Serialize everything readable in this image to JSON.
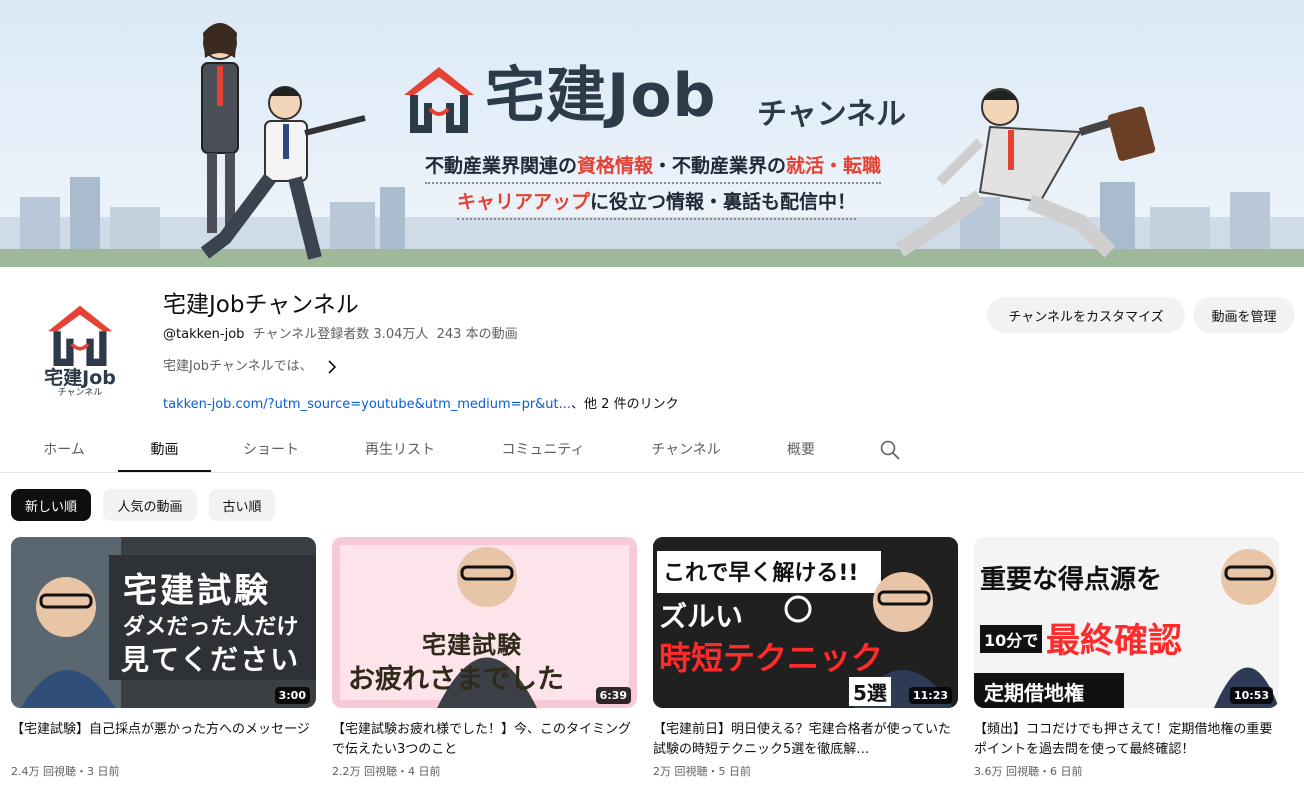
{
  "banner": {
    "title": "宅建Job",
    "subtitle": "チャンネル",
    "line1_a": "不動産業界関連の",
    "line1_hl1": "資格情報",
    "line1_b": "・不動産業界の",
    "line1_hl2": "就活・転職",
    "line2_hl": "キャリアアップ",
    "line2_b": "に役立つ情報・裏話も配信中！"
  },
  "channel": {
    "avatar_text": "宅建Job",
    "avatar_sub": "チャンネル",
    "name": "宅建Jobチャンネル",
    "handle": "@takken-job",
    "subscribers": "チャンネル登録者数 3.04万人",
    "video_count": "243 本の動画",
    "description": "宅建Jobチャンネルでは、",
    "link": "takken-job.com/?utm_source=youtube&utm_medium=pr&ut...",
    "link_more": "、他 2 件のリンク"
  },
  "actions": {
    "customize": "チャンネルをカスタマイズ",
    "manage": "動画を管理"
  },
  "tabs": [
    {
      "label": "ホーム"
    },
    {
      "label": "動画"
    },
    {
      "label": "ショート"
    },
    {
      "label": "再生リスト"
    },
    {
      "label": "コミュニティ"
    },
    {
      "label": "チャンネル"
    },
    {
      "label": "概要"
    }
  ],
  "chips": [
    {
      "label": "新しい順"
    },
    {
      "label": "人気の動画"
    },
    {
      "label": "古い順"
    }
  ],
  "videos": [
    {
      "thumb_lines": [
        "宅建試験",
        "ダメだった人だけ",
        "見てください"
      ],
      "duration": "3:00",
      "title": "【宅建試験】自己採点が悪かった方へのメッセージ",
      "meta": "2.4万 回視聴・3 日前",
      "progress": 0.0
    },
    {
      "thumb_lines": [
        "宅建試験",
        "お疲れさまでした"
      ],
      "duration": "6:39",
      "title": "【宅建試験お疲れ様でした！】今、このタイミングで伝えたい3つのこと",
      "meta": "2.2万 回視聴・4 日前",
      "progress": 0.0
    },
    {
      "thumb_lines": [
        "これで早く解ける!!",
        "ズルい",
        "時短テクニック",
        "5選"
      ],
      "duration": "11:23",
      "title": "【宅建前日】明日使える？宅建合格者が使っていた試験の時短テクニック5選を徹底解…",
      "meta": "2万 回視聴・5 日前",
      "progress": 0.0
    },
    {
      "thumb_lines": [
        "重要な得点源を",
        "10分で",
        "最終確認",
        "定期借地権"
      ],
      "duration": "10:53",
      "title": "【頻出】ココだけでも押さえて！定期借地権の重要ポイントを過去問を使って最終確認！",
      "meta": "3.6万 回視聴・6 日前",
      "progress": 0.0
    }
  ],
  "colors": {
    "accent_red": "#e34234",
    "link_blue": "#065fd4",
    "dark_navy": "#2d3a4a"
  }
}
